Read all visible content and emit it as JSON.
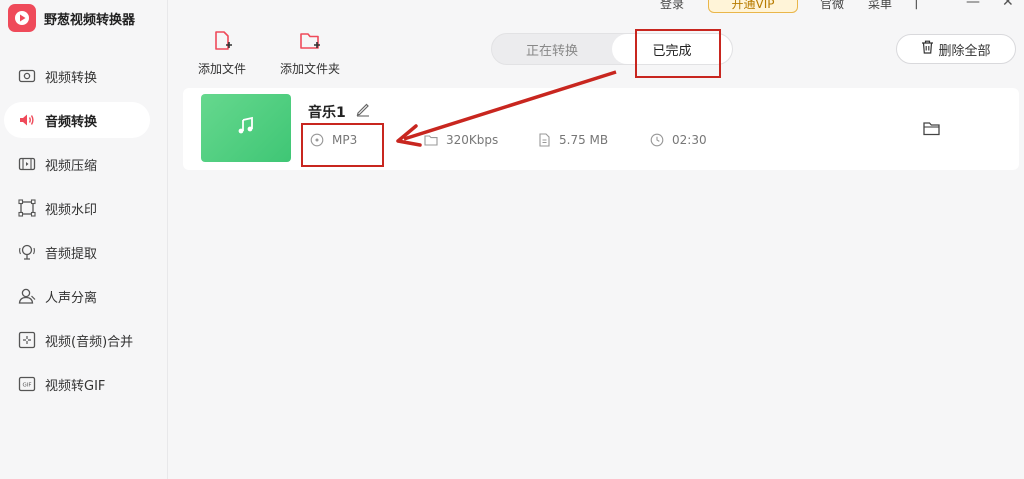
{
  "app": {
    "title": "野葱视频转换器"
  },
  "topbar": {
    "login": "登录",
    "vip": "开通VIP",
    "feedback": "官微",
    "menu": "菜单"
  },
  "sidebar": {
    "items": [
      {
        "label": "视频转换",
        "icon": "video-convert-icon",
        "active": false
      },
      {
        "label": "音频转换",
        "icon": "audio-convert-icon",
        "active": true
      },
      {
        "label": "视频压缩",
        "icon": "video-compress-icon",
        "active": false
      },
      {
        "label": "视频水印",
        "icon": "watermark-icon",
        "active": false
      },
      {
        "label": "音频提取",
        "icon": "audio-extract-icon",
        "active": false
      },
      {
        "label": "人声分离",
        "icon": "voice-separate-icon",
        "active": false
      },
      {
        "label": "视频(音频)合并",
        "icon": "merge-icon",
        "active": false
      },
      {
        "label": "视频转GIF",
        "icon": "gif-icon",
        "active": false
      }
    ]
  },
  "toolbar": {
    "add_file": "添加文件",
    "add_folder": "添加文件夹",
    "delete_all": "删除全部"
  },
  "tabs": {
    "converting": "正在转换",
    "completed": "已完成",
    "active": "completed"
  },
  "file": {
    "name": "音乐1",
    "format": "MP3",
    "bitrate": "320Kbps",
    "size": "5.75 MB",
    "duration": "02:30"
  },
  "colors": {
    "brand": "#ef4a5a",
    "accent_red": "#c8261f",
    "thumb_green": "#4cc97b"
  }
}
